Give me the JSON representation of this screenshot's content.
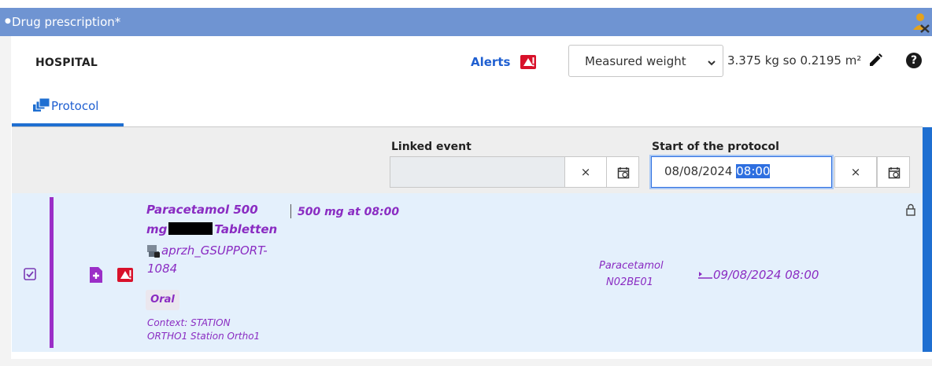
{
  "window": {
    "title": "Drug prescription*",
    "title_bg": "#6f94d2"
  },
  "header": {
    "org": "HOSPITAL",
    "alerts_label": "Alerts",
    "weight_mode": "Measured weight",
    "weight_value": "3.375 kg so 0.2195 m²",
    "help_label": "?"
  },
  "tabs": [
    {
      "label": "Protocol",
      "active": true
    }
  ],
  "filter": {
    "linked_event_label": "Linked event",
    "linked_event_value": "",
    "start_label": "Start of the protocol",
    "start_date": "08/08/2024 ",
    "start_time_selected": "08:00",
    "clear_label": "×"
  },
  "prescription": {
    "drug_line1": "Paracetamol 500",
    "drug_line2_a": "mg",
    "drug_line2_b": "Tabletten",
    "source_line1": "aprzh_GSUPPORT-",
    "source_line2": "1084",
    "route": "Oral",
    "context_line1": "Context: STATION",
    "context_line2": "ORTHO1 Station Ortho1",
    "dose": "500 mg at 08:00",
    "substance": "Paracetamol",
    "atc_code": "N02BE01",
    "end_date": "09/08/2024 08:00",
    "accent_color": "#8a2cc2",
    "selected": true
  },
  "icons": {
    "alert": "alert-badge-icon",
    "user": "user-warning-icon",
    "edit": "pencil-icon",
    "help": "help-icon",
    "tab": "protocol-icon",
    "calendar": "calendar-icon",
    "lock": "lock-icon",
    "check": "checkbox-icon",
    "add_doc": "add-document-icon",
    "server": "server-icon",
    "arrow": "arrow-right-icon"
  }
}
